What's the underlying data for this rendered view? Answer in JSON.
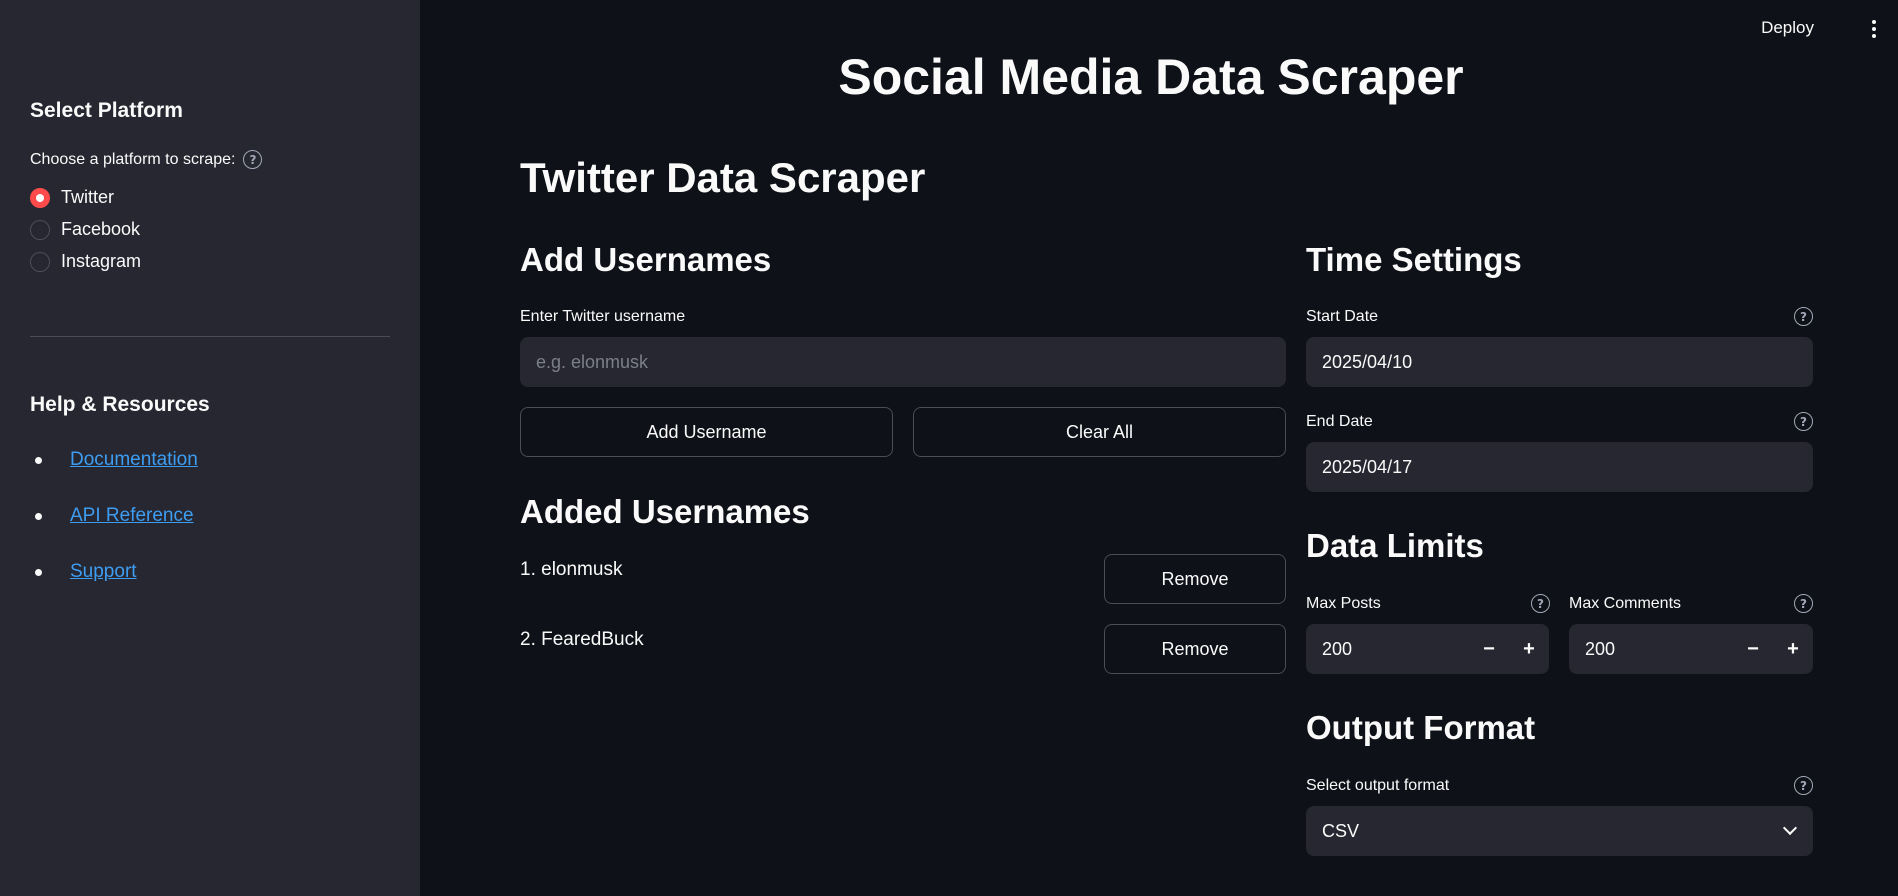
{
  "sidebar": {
    "platform_heading": "Select Platform",
    "platform_label": "Choose a platform to scrape:",
    "platforms": [
      {
        "label": "Twitter",
        "selected": true
      },
      {
        "label": "Facebook",
        "selected": false
      },
      {
        "label": "Instagram",
        "selected": false
      }
    ],
    "resources_heading": "Help & Resources",
    "resources": [
      "Documentation",
      "API Reference",
      "Support"
    ]
  },
  "header": {
    "deploy_label": "Deploy"
  },
  "main": {
    "title": "Social Media Data Scraper",
    "subtitle": "Twitter Data Scraper",
    "add_usernames": {
      "heading": "Add Usernames",
      "input_label": "Enter Twitter username",
      "input_placeholder": "e.g. elonmusk",
      "add_button": "Add Username",
      "clear_button": "Clear All"
    },
    "added_usernames": {
      "heading": "Added Usernames",
      "items": [
        "1. elonmusk",
        "2. FearedBuck"
      ],
      "remove_label": "Remove"
    },
    "time_settings": {
      "heading": "Time Settings",
      "start_label": "Start Date",
      "start_value": "2025/04/10",
      "end_label": "End Date",
      "end_value": "2025/04/17"
    },
    "data_limits": {
      "heading": "Data Limits",
      "max_posts_label": "Max Posts",
      "max_posts_value": "200",
      "max_comments_label": "Max Comments",
      "max_comments_value": "200",
      "minus": "−",
      "plus": "+"
    },
    "output_format": {
      "heading": "Output Format",
      "label": "Select output format",
      "value": "CSV"
    },
    "help_glyph": "?"
  },
  "colors": {
    "background": "#0e1117",
    "sidebar": "#262730",
    "accent": "#ff4b4b",
    "link": "#3d9df3"
  }
}
